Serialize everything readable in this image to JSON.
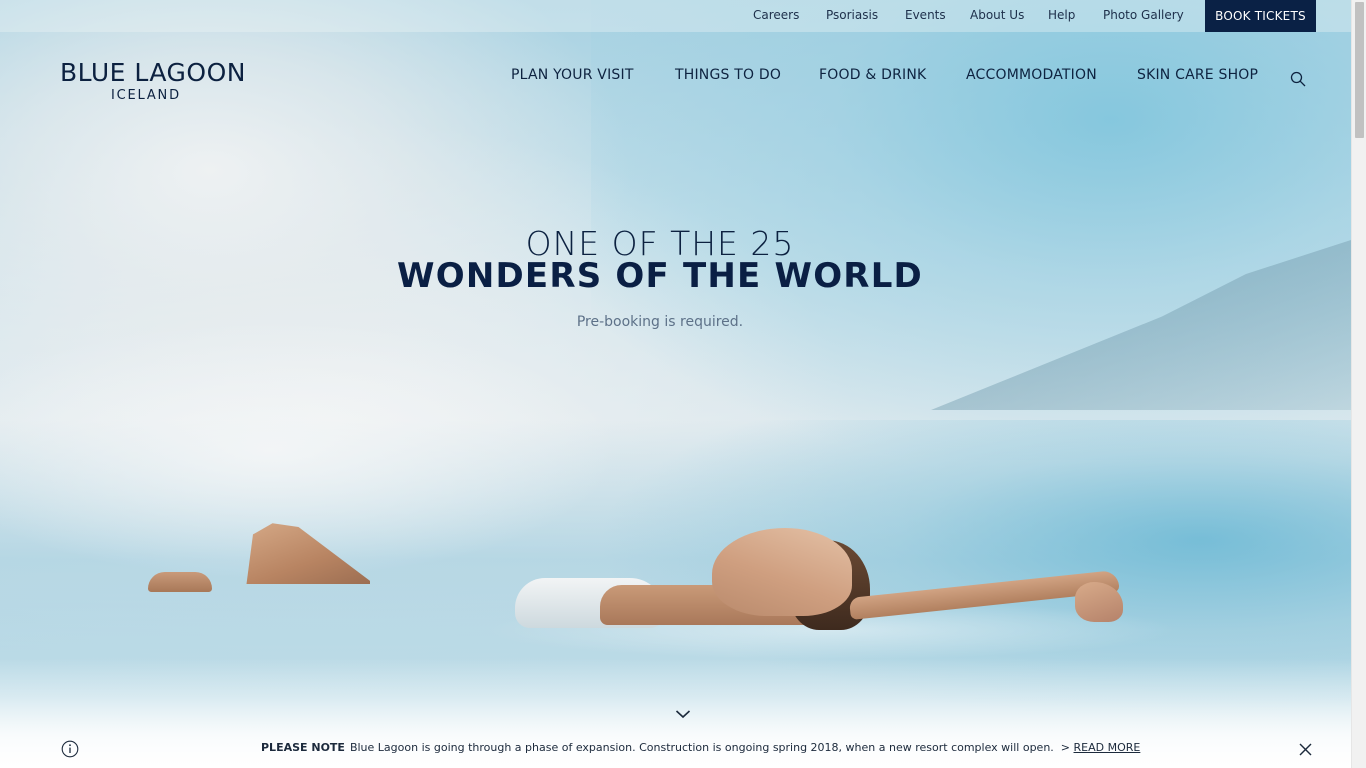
{
  "utility_nav": {
    "links": [
      {
        "label": "Careers"
      },
      {
        "label": "Psoriasis"
      },
      {
        "label": "Events"
      },
      {
        "label": "About Us"
      },
      {
        "label": "Help"
      },
      {
        "label": "Photo Gallery"
      }
    ],
    "book_label": "BOOK TICKETS"
  },
  "logo": {
    "main": "BLUE LAGOON",
    "sub": "ICELAND"
  },
  "main_nav": {
    "items": [
      {
        "label": "PLAN YOUR VISIT"
      },
      {
        "label": "THINGS TO DO"
      },
      {
        "label": "FOOD & DRINK"
      },
      {
        "label": "ACCOMMODATION"
      },
      {
        "label": "SKIN CARE SHOP"
      }
    ],
    "search_icon": "search-icon"
  },
  "hero": {
    "line1": "ONE OF THE 25",
    "line2": "WONDERS OF THE WORLD",
    "subline": "Pre-booking is required.",
    "scroll_icon": "chevron-down-icon"
  },
  "notice": {
    "icon": "info-icon",
    "label": "PLEASE NOTE",
    "text": "Blue Lagoon is going through a phase of expansion. Construction is ongoing spring 2018, when a new resort complex will open.",
    "link_prefix": ">",
    "link_text": "READ MORE",
    "close_icon": "close-icon"
  },
  "colors": {
    "brand_navy": "#0a2145",
    "text_dark": "#0c2140",
    "subtext": "#5d7188"
  }
}
